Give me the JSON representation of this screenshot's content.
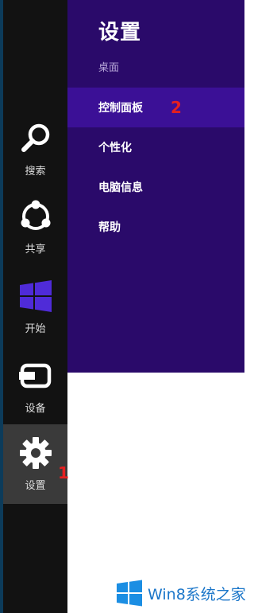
{
  "charms": {
    "items": [
      {
        "label": "搜索",
        "icon": "search-icon"
      },
      {
        "label": "共享",
        "icon": "share-icon"
      },
      {
        "label": "开始",
        "icon": "windows-start-icon"
      },
      {
        "label": "设备",
        "icon": "devices-icon"
      },
      {
        "label": "设置",
        "icon": "gear-icon",
        "active": true
      }
    ]
  },
  "panel": {
    "title": "设置",
    "subtitle": "桌面",
    "menu": [
      {
        "label": "控制面板",
        "active": true
      },
      {
        "label": "个性化"
      },
      {
        "label": "电脑信息"
      },
      {
        "label": "帮助"
      }
    ]
  },
  "annotations": {
    "step1": "1",
    "step2": "2"
  },
  "watermark": {
    "text": "Win8系统之家",
    "logo": "windows-logo-icon"
  },
  "colors": {
    "panel_bg": "#2a0a6a",
    "menu_active_bg": "#3b1096",
    "charm_bar_bg": "#121212",
    "charm_active_bg": "#3a3a3a",
    "annotation": "#e51f1f",
    "watermark": "#1b76c9"
  }
}
